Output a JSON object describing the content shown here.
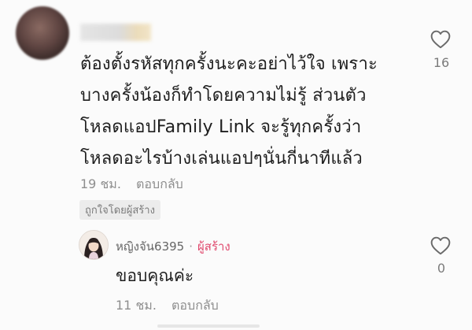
{
  "comment": {
    "username": "",
    "lines": [
      "ต้องตั้งรหัสทุกครั้งนะคะอย่าไว้ใจ เพราะ",
      "บางครั้งน้องก็ทำโดยความไม่รู้ ส่วนตัว",
      "โหลดแอปFamily Link จะรู้ทุกครั้งว่า",
      "โหลดอะไรบ้างเล่นแอปๆนั่นกี่นาทีแล้ว"
    ],
    "time": "19 ชม.",
    "reply_label": "ตอบกลับ",
    "liked_by_creator": "ถูกใจโดยผู้สร้าง",
    "like_count": "16",
    "like_icon": "heart-outline"
  },
  "reply": {
    "username": "หญิงจัน6395",
    "separator": "·",
    "creator_badge": "ผู้สร้าง",
    "text": "ขอบคุณค่ะ",
    "time": "11 ชม.",
    "reply_label": "ตอบกลับ",
    "like_count": "0",
    "like_icon": "heart-outline",
    "accent_color": "#e04a6e"
  }
}
